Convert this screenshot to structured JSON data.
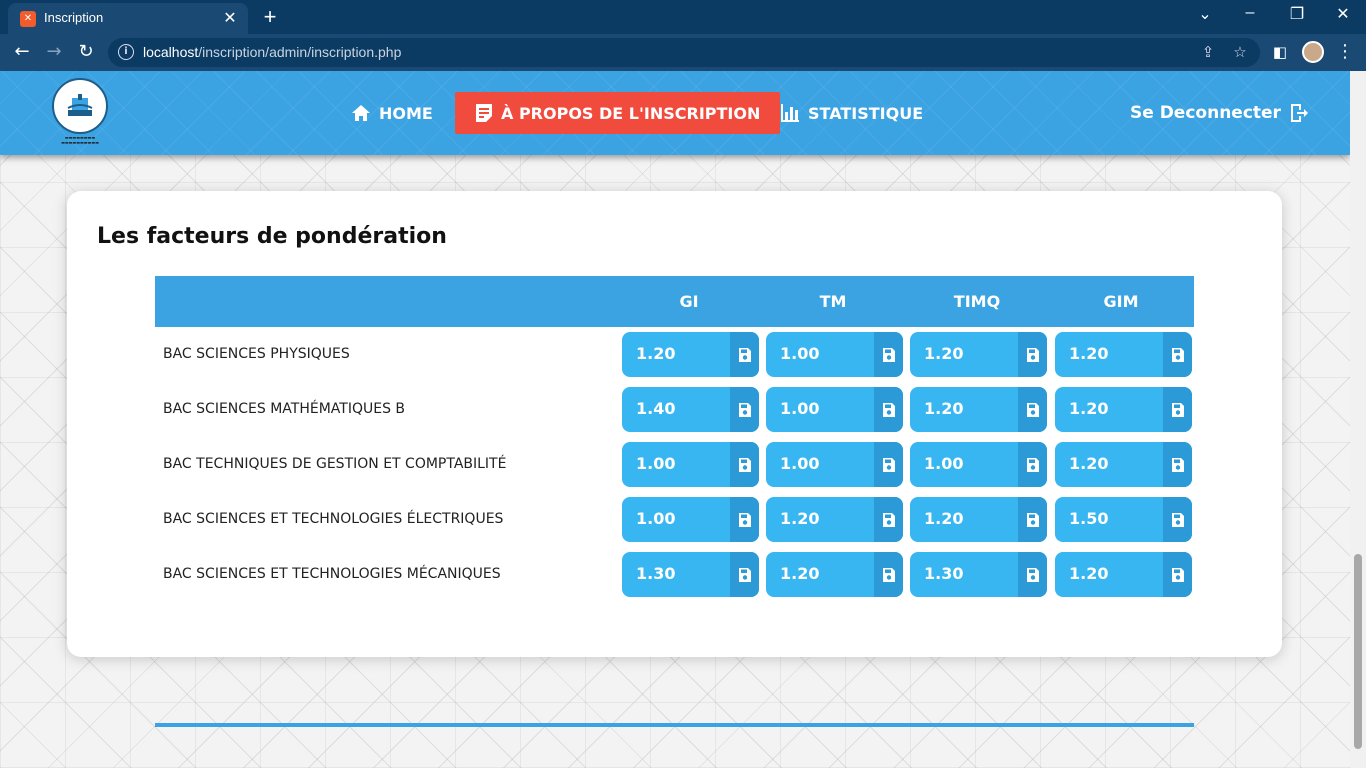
{
  "browser": {
    "tab_title": "Inscription",
    "url_host": "localhost",
    "url_path": "/inscription/admin/inscription.php"
  },
  "nav": {
    "home": "HOME",
    "about": "À PROPOS DE L'INSCRIPTION",
    "stats": "STATISTIQUE",
    "logout": "Se Deconnecter"
  },
  "main": {
    "title": "Les facteurs de pondération",
    "columns": [
      "GI",
      "TM",
      "TIMQ",
      "GIM"
    ],
    "rows": [
      {
        "label": "BAC SCIENCES PHYSIQUES",
        "values": [
          "1.20",
          "1.00",
          "1.20",
          "1.20"
        ]
      },
      {
        "label": "BAC SCIENCES MATHÉMATIQUES B",
        "values": [
          "1.40",
          "1.00",
          "1.20",
          "1.20"
        ]
      },
      {
        "label": "BAC TECHNIQUES DE GESTION ET COMPTABILITÉ",
        "values": [
          "1.00",
          "1.00",
          "1.00",
          "1.20"
        ]
      },
      {
        "label": "BAC SCIENCES ET TECHNOLOGIES ÉLECTRIQUES",
        "values": [
          "1.00",
          "1.20",
          "1.20",
          "1.50"
        ]
      },
      {
        "label": "BAC SCIENCES ET TECHNOLOGIES MÉCANIQUES",
        "values": [
          "1.30",
          "1.20",
          "1.30",
          "1.20"
        ]
      }
    ]
  },
  "colors": {
    "primary": "#3ba3e2",
    "active_nav": "#f14b3e",
    "cell": "#38b6f2"
  }
}
